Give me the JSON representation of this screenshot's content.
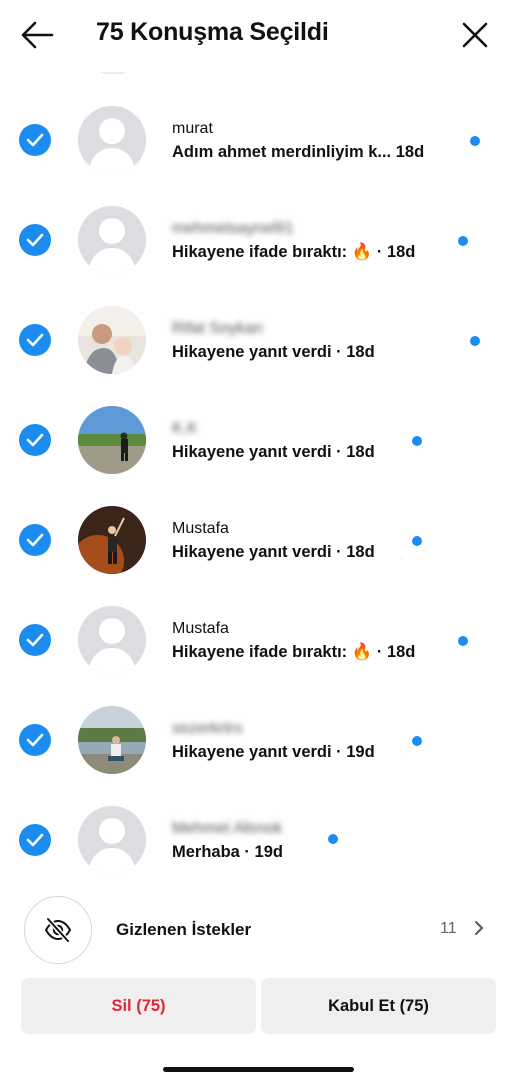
{
  "header": {
    "title": "75 Konuşma Seçildi",
    "back_icon": "arrow-left-icon",
    "close_icon": "close-icon"
  },
  "colors": {
    "accent": "#1d8cf0",
    "danger": "#e0263b",
    "button_bg": "#efefef"
  },
  "conversations": [
    {
      "name": "murat",
      "name_blurred": false,
      "subtitle": "Adım ahmet merdinliyim k... 18d",
      "avatar": "default",
      "selected": true,
      "unread": true
    },
    {
      "name": "mehmetsaynel91",
      "name_blurred": true,
      "subtitle": "Hikayene ifade bıraktı: 🔥 · 18d",
      "avatar": "default",
      "selected": true,
      "unread": true
    },
    {
      "name": "Rifat Soykan",
      "name_blurred": true,
      "subtitle": "Hikayene yanıt verdi · 18d",
      "avatar": "photo-man-child",
      "selected": true,
      "unread": true
    },
    {
      "name": "K.K",
      "name_blurred": true,
      "subtitle": "Hikayene yanıt verdi · 18d",
      "avatar": "photo-landscape-person",
      "selected": true,
      "unread": true
    },
    {
      "name": "Mustafa",
      "name_blurred": false,
      "subtitle": "Hikayene yanıt verdi · 18d",
      "avatar": "photo-night-person",
      "selected": true,
      "unread": true
    },
    {
      "name": "Mustafa",
      "name_blurred": false,
      "subtitle": "Hikayene ifade bıraktı: 🔥 · 18d",
      "avatar": "default",
      "selected": true,
      "unread": true
    },
    {
      "name": "sezerkrtrs",
      "name_blurred": true,
      "subtitle": "Hikayene yanıt verdi · 19d",
      "avatar": "photo-lake-person",
      "selected": true,
      "unread": true
    },
    {
      "name": "Mehmet Altınok",
      "name_blurred": true,
      "subtitle": "Merhaba · 19d",
      "avatar": "default",
      "selected": true,
      "unread": true
    }
  ],
  "hidden_requests": {
    "label": "Gizlenen İstekler",
    "count": "11",
    "icon": "eye-off-icon"
  },
  "actions": {
    "delete_label": "Sil (75)",
    "accept_label": "Kabul Et (75)"
  }
}
